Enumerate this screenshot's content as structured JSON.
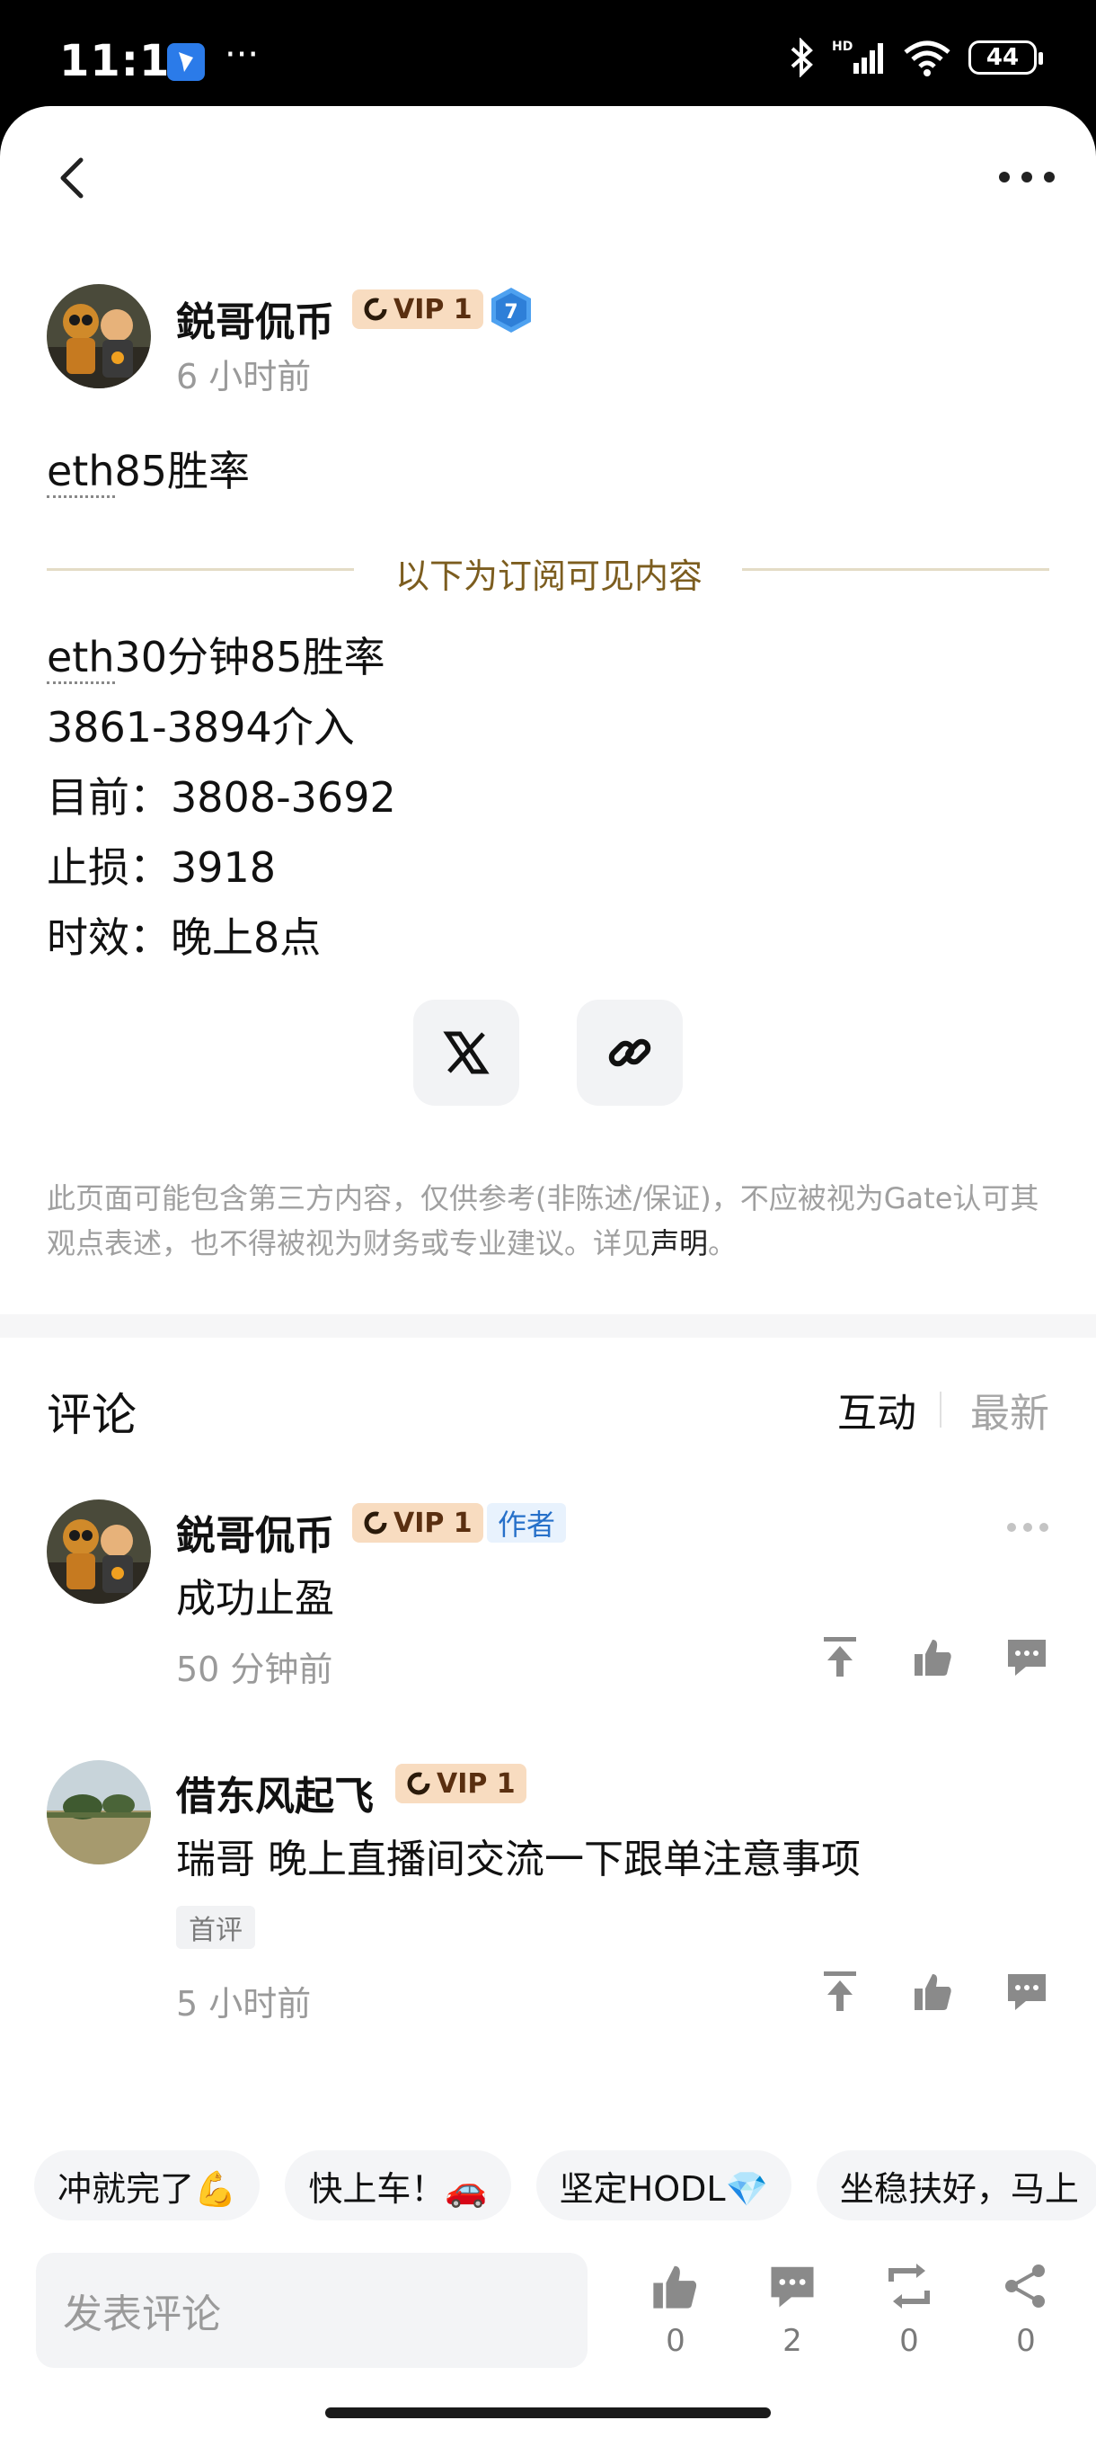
{
  "status_bar": {
    "time": "11:10",
    "dots": "···",
    "battery": "44"
  },
  "author": {
    "name": "鋭哥侃币",
    "vip": "VIP 1",
    "level": "7",
    "time": "6 小时前"
  },
  "post": {
    "title": "eth85胜率",
    "title_dotted": "eth",
    "title_rest": "85胜率",
    "subscriber_divider": "以下为订阅可见内容",
    "lines": [
      {
        "dotted": "eth",
        "rest": "30分钟85胜率"
      },
      {
        "dotted": "",
        "rest": "3861-3894介入"
      },
      {
        "dotted": "",
        "rest": "目前：3808-3692"
      },
      {
        "dotted": "",
        "rest": "止损：3918"
      },
      {
        "dotted": "",
        "rest": "时效：晚上8点"
      }
    ]
  },
  "disclaimer": {
    "text": "此页面可能包含第三方内容，仅供参考(非陈述/保证)，不应被视为Gate认可其观点表述，也不得被视为财务或专业建议。详见",
    "link": "声明",
    "end": "。"
  },
  "comments_section": {
    "title": "评论",
    "tab_active": "互动",
    "tab_inactive": "最新"
  },
  "comments": [
    {
      "name": "鋭哥侃币",
      "vip": "VIP 1",
      "tag": "作者",
      "text": "成功止盈",
      "time": "50 分钟前"
    },
    {
      "name": "借东风起飞",
      "vip": "VIP 1",
      "badge": "首评",
      "text": "瑞哥 晚上直播间交流一下跟单注意事项",
      "time": "5 小时前"
    }
  ],
  "quick_replies": [
    "冲就完了💪",
    "快上车！🚗",
    "坚定HODL💎",
    "坐稳扶好，马上"
  ],
  "bottom": {
    "placeholder": "发表评论",
    "likes": "0",
    "comments": "2",
    "reposts": "0",
    "shares": "0"
  },
  "colors": {
    "vip_bg": "#f8dcc0",
    "divider_gold": "#7c5d1f",
    "author_tag": "#2670c9"
  }
}
